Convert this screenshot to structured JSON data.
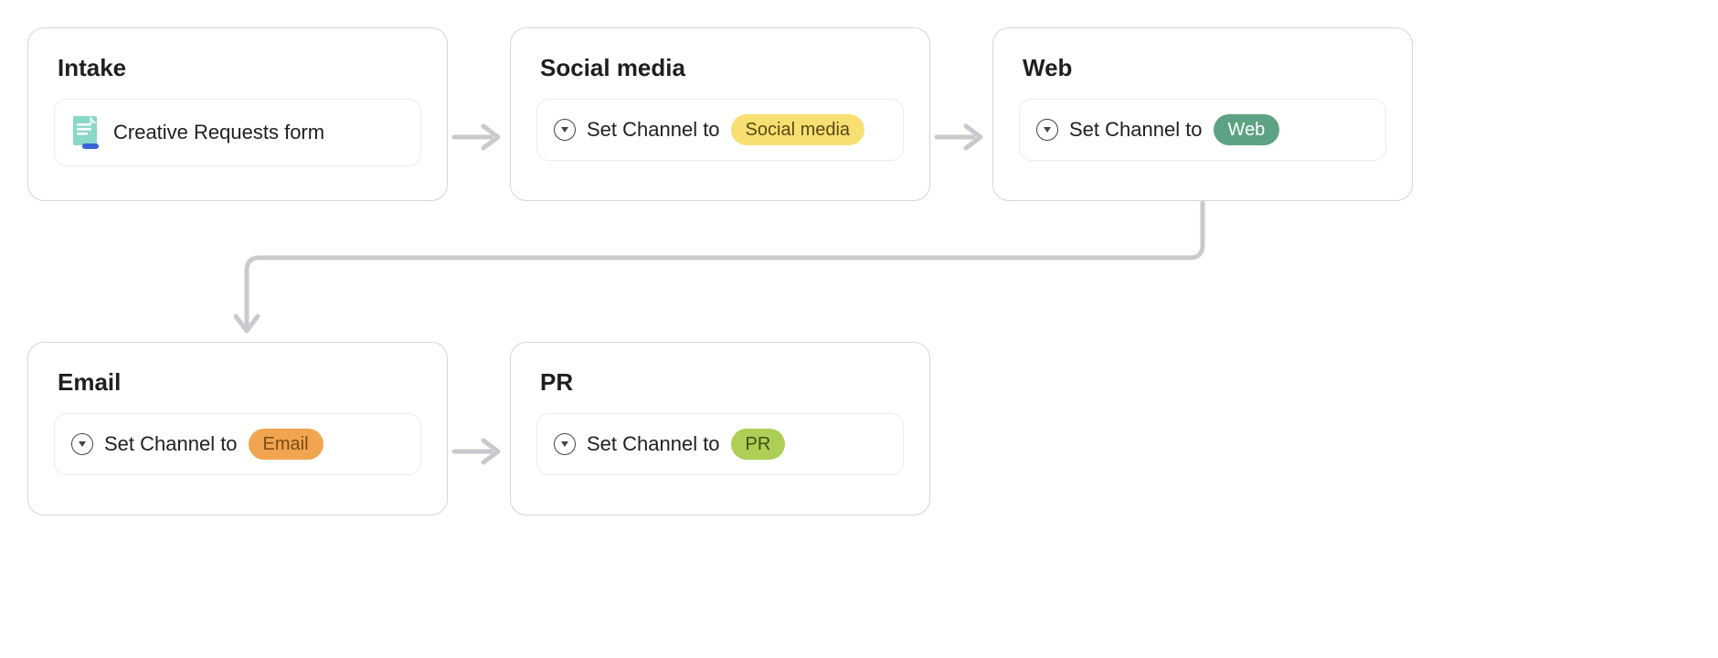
{
  "cards": {
    "intake": {
      "title": "Intake",
      "form_label": "Creative Requests form"
    },
    "social": {
      "title": "Social media",
      "action_prefix": "Set Channel to",
      "tag": "Social media"
    },
    "web": {
      "title": "Web",
      "action_prefix": "Set Channel to",
      "tag": "Web"
    },
    "email": {
      "title": "Email",
      "action_prefix": "Set Channel to",
      "tag": "Email"
    },
    "pr": {
      "title": "PR",
      "action_prefix": "Set Channel to",
      "tag": "PR"
    }
  },
  "colors": {
    "card_border": "#d6d6d8",
    "inner_border": "#ececee",
    "arrow": "#c9cacd",
    "tag_yellow_bg": "#f8df72",
    "tag_teal_bg": "#5da283",
    "tag_orange_bg": "#f1a550",
    "tag_green_bg": "#aecf55"
  }
}
